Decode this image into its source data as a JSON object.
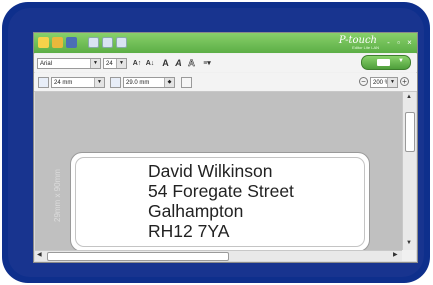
{
  "app": {
    "brand": "P-touch",
    "brand_sub": "Editor Lite LAN"
  },
  "window_controls": [
    "-",
    "▫",
    "×"
  ],
  "format_bar": {
    "font": "Arial",
    "size": "24",
    "buttons": [
      "A↑",
      "A↓",
      "A",
      "A",
      "A",
      "≡▾"
    ]
  },
  "tape_bar": {
    "tape_width": "24 mm",
    "label_length": "29.0 mm",
    "zoom": "200 %"
  },
  "label": {
    "lines": [
      "David Wilkinson",
      "54 Foregate Street",
      "Galhampton",
      "RH12 7YA"
    ],
    "dimension": "29mm x 90mm"
  },
  "colors": {
    "frame": "#0e2f8c",
    "titlebar": "#6dbb53",
    "workspace": "#c0c0c0"
  }
}
